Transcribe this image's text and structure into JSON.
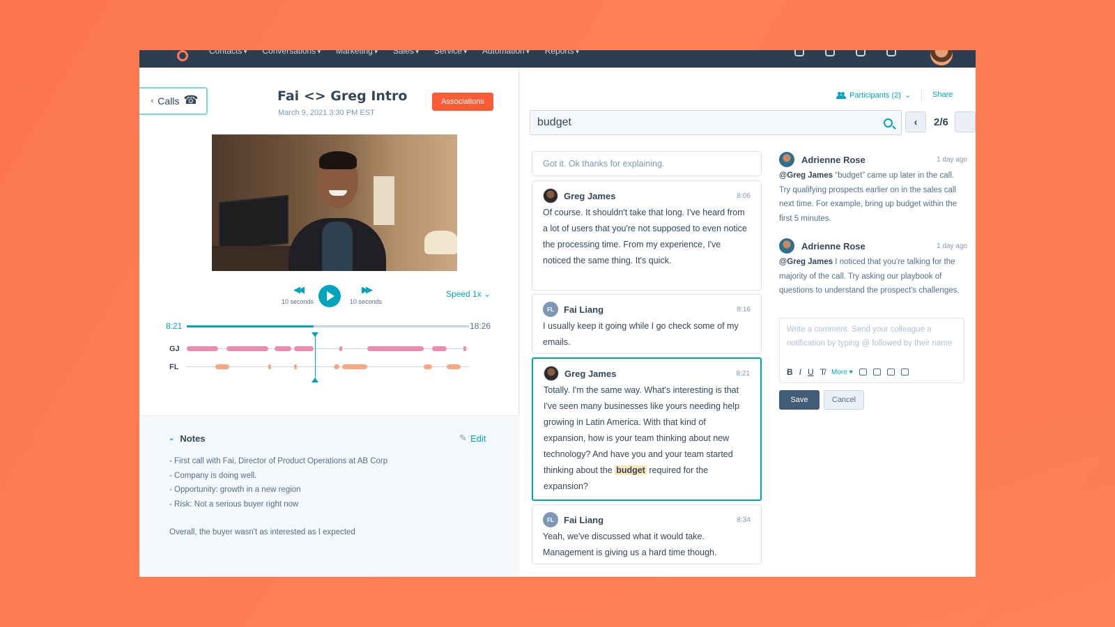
{
  "nav": {
    "items": [
      "Contacts",
      "Conversations",
      "Marketing",
      "Sales",
      "Service",
      "Automation",
      "Reports"
    ]
  },
  "call": {
    "back_label": "Calls",
    "title": "Fai <> Greg Intro",
    "date": "March 9, 2021 3:30 PM EST",
    "associations_label": "Associations"
  },
  "player": {
    "rewind_label": "10 seconds",
    "forward_label": "10 seconds",
    "speed_label": "Speed 1x",
    "current_time": "8:21",
    "total_time": "18:26",
    "progress": 0.45,
    "speakers": [
      {
        "label": "GJ",
        "segments": [
          [
            0,
            0.11
          ],
          [
            0.14,
            0.29
          ],
          [
            0.31,
            0.37
          ],
          [
            0.38,
            0.45
          ],
          [
            0.54,
            0.55
          ],
          [
            0.64,
            0.84
          ],
          [
            0.87,
            0.92
          ],
          [
            0.98,
            0.99
          ]
        ]
      },
      {
        "label": "FL",
        "segments": [
          [
            0.1,
            0.15
          ],
          [
            0.29,
            0.3
          ],
          [
            0.38,
            0.39
          ],
          [
            0.52,
            0.54
          ],
          [
            0.55,
            0.64
          ],
          [
            0.84,
            0.87
          ],
          [
            0.92,
            0.97
          ]
        ]
      }
    ]
  },
  "notes": {
    "title": "Notes",
    "edit_label": "Edit",
    "lines": [
      "- First call with Fai, Director of Product Operations at AB Corp",
      "- Company is doing well.",
      "- Opportunity: growth in a new region",
      "- Risk: Not a serious buyer right now"
    ],
    "summary": "Overall, the buyer wasn't as interested as I expected"
  },
  "right": {
    "participants_label": "Participants (2)",
    "share_label": "Share",
    "search_value": "budget",
    "match_count": "2/6"
  },
  "transcript": {
    "partial_text": "Got it. Ok thanks for explaining.",
    "messages": [
      {
        "speaker": "Greg James",
        "initials": "",
        "time": "8:06",
        "text": "Of course. It shouldn't take that long. I've heard from a lot of users that you're not supposed to even notice the processing time. From my experience, I've noticed the same thing. It's quick."
      },
      {
        "speaker": "Fai Liang",
        "initials": "FL",
        "time": "8:16",
        "text": "I usually keep it going while I go check some of my emails."
      },
      {
        "speaker": "Greg James",
        "initials": "",
        "time": "8:21",
        "text_before": "Totally. I'm the same way. What's interesting is that I've seen many businesses like yours needing help growing in Latin America. With that kind of expansion, how is your team thinking about new technology? And have you and your team started thinking about the",
        "highlight": "budget",
        "text_after": "required for the expansion?"
      },
      {
        "speaker": "Fai Liang",
        "initials": "FL",
        "time": "8:34",
        "text": "Yeah, we've discussed what it would take. Management is giving us a hard time though."
      }
    ]
  },
  "comments": {
    "items": [
      {
        "author": "Adrienne Rose",
        "time": "1 day ago",
        "mention": "@Greg James",
        "text": "“budget” came up later in the call. Try qualifying prospects earlier on in the sales call next time. For example, bring up budget within the first 5 minutes."
      },
      {
        "author": "Adrienne Rose",
        "time": "1 day ago",
        "mention": "@Greg James",
        "text": "I noticed that you're talking for the majority of the call. Try asking our playbook of questions to understand the prospect's challenges."
      }
    ],
    "placeholder": "Write a comment. Send your colleague a notification by typing @ followed by their name",
    "toolbar": {
      "bold": "B",
      "italic": "I",
      "underline": "U",
      "clear": "T̸",
      "more": "More ▾"
    },
    "save_label": "Save",
    "cancel_label": "Cancel"
  },
  "colors": {
    "accent": "#00a4bd",
    "brand": "#ff5c35",
    "gj_segment": "#f08bac",
    "fl_segment": "#f8a782",
    "background": "#ff7e55"
  }
}
